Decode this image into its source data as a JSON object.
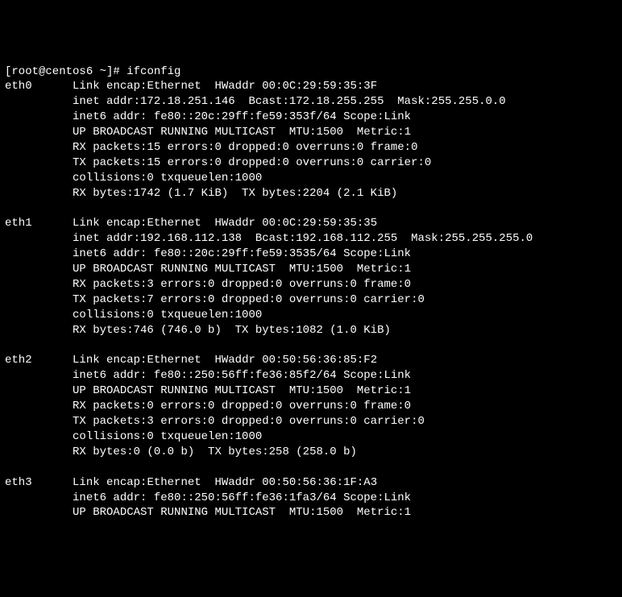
{
  "prompt": "[root@centos6 ~]# ",
  "command": "ifconfig",
  "interfaces": [
    {
      "name": "eth0",
      "lines": [
        "Link encap:Ethernet  HWaddr 00:0C:29:59:35:3F",
        "inet addr:172.18.251.146  Bcast:172.18.255.255  Mask:255.255.0.0",
        "inet6 addr: fe80::20c:29ff:fe59:353f/64 Scope:Link",
        "UP BROADCAST RUNNING MULTICAST  MTU:1500  Metric:1",
        "RX packets:15 errors:0 dropped:0 overruns:0 frame:0",
        "TX packets:15 errors:0 dropped:0 overruns:0 carrier:0",
        "collisions:0 txqueuelen:1000",
        "RX bytes:1742 (1.7 KiB)  TX bytes:2204 (2.1 KiB)"
      ]
    },
    {
      "name": "eth1",
      "lines": [
        "Link encap:Ethernet  HWaddr 00:0C:29:59:35:35",
        "inet addr:192.168.112.138  Bcast:192.168.112.255  Mask:255.255.255.0",
        "inet6 addr: fe80::20c:29ff:fe59:3535/64 Scope:Link",
        "UP BROADCAST RUNNING MULTICAST  MTU:1500  Metric:1",
        "RX packets:3 errors:0 dropped:0 overruns:0 frame:0",
        "TX packets:7 errors:0 dropped:0 overruns:0 carrier:0",
        "collisions:0 txqueuelen:1000",
        "RX bytes:746 (746.0 b)  TX bytes:1082 (1.0 KiB)"
      ]
    },
    {
      "name": "eth2",
      "lines": [
        "Link encap:Ethernet  HWaddr 00:50:56:36:85:F2",
        "inet6 addr: fe80::250:56ff:fe36:85f2/64 Scope:Link",
        "UP BROADCAST RUNNING MULTICAST  MTU:1500  Metric:1",
        "RX packets:0 errors:0 dropped:0 overruns:0 frame:0",
        "TX packets:3 errors:0 dropped:0 overruns:0 carrier:0",
        "collisions:0 txqueuelen:1000",
        "RX bytes:0 (0.0 b)  TX bytes:258 (258.0 b)"
      ]
    },
    {
      "name": "eth3",
      "lines": [
        "Link encap:Ethernet  HWaddr 00:50:56:36:1F:A3",
        "inet6 addr: fe80::250:56ff:fe36:1fa3/64 Scope:Link",
        "UP BROADCAST RUNNING MULTICAST  MTU:1500  Metric:1"
      ]
    }
  ]
}
